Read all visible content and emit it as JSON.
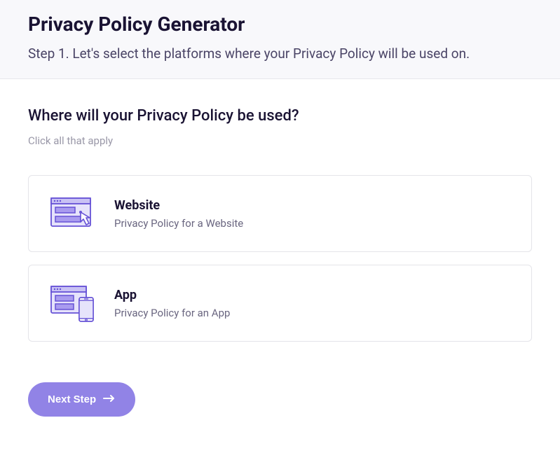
{
  "header": {
    "title": "Privacy Policy Generator",
    "subtitle": "Step 1. Let's select the platforms where your Privacy Policy will be used on."
  },
  "form": {
    "question": "Where will your Privacy Policy be used?",
    "hint": "Click all that apply",
    "options": [
      {
        "title": "Website",
        "description": "Privacy Policy for a Website"
      },
      {
        "title": "App",
        "description": "Privacy Policy for an App"
      }
    ]
  },
  "actions": {
    "next_label": "Next Step"
  }
}
